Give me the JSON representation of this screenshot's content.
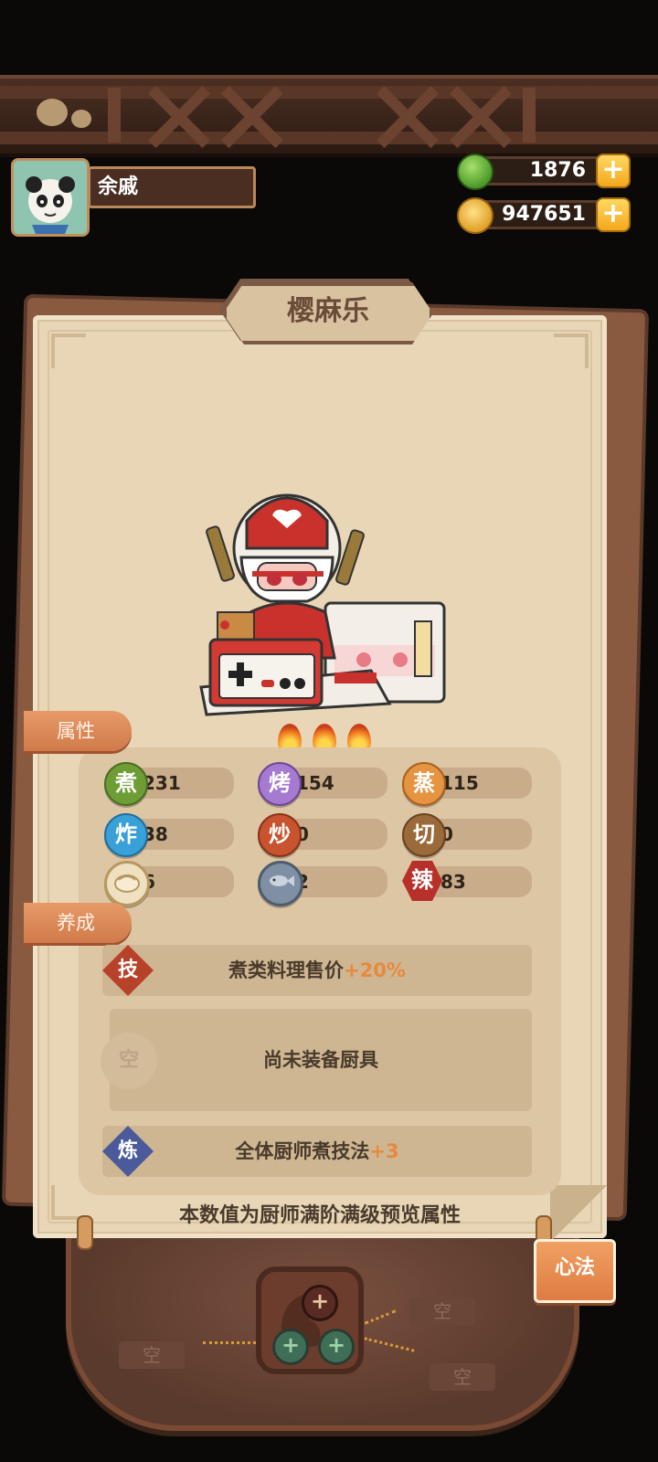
{
  "header": {
    "player_name": "余戚",
    "green_currency": "1876",
    "coin_currency": "947651",
    "plus_symbol": "+"
  },
  "chef": {
    "name": "樱麻乐",
    "star_count": 3
  },
  "attributes": {
    "tab_label": "属性",
    "items": [
      {
        "badge": "煮",
        "value": "231",
        "color": "#6f9d35"
      },
      {
        "badge": "烤",
        "value": "154",
        "color": "#a57ad0"
      },
      {
        "badge": "蒸",
        "value": "115",
        "color": "#e59441"
      },
      {
        "badge": "炸",
        "value": "38",
        "color": "#3aa0d8"
      },
      {
        "badge": "炒",
        "value": "0",
        "color": "#c8542f"
      },
      {
        "badge": "切",
        "value": "0",
        "color": "#9a6a3a"
      },
      {
        "badge": "bun-icon",
        "value": "6"
      },
      {
        "badge": "fish-icon",
        "value": "2"
      },
      {
        "badge": "辣",
        "value": "83",
        "color": "#b8302a"
      }
    ]
  },
  "cultivation": {
    "tab_label": "养成",
    "skill": {
      "badge": "技",
      "text": "煮类料理售价",
      "bonus": "+20%"
    },
    "tool": {
      "badge": "空",
      "text": "尚未装备厨具"
    },
    "refine": {
      "badge": "炼",
      "text": "全体厨师煮技法",
      "bonus": "+3"
    }
  },
  "footnote": "本数值为厨师满阶满级预览属性",
  "xinfa_button": "心法",
  "slots": {
    "empty_label": "空"
  },
  "colors": {
    "accent_orange": "#e68a3d",
    "parchment": "#e8d6b6",
    "wood": "#4a2e22"
  }
}
